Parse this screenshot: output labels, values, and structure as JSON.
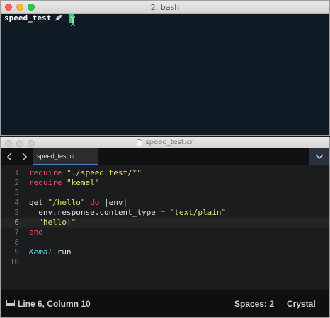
{
  "terminal": {
    "title": "2. bash",
    "prompt": "speed_test"
  },
  "editor": {
    "title": "speed_test.cr",
    "tab_label": "speed_test.cr",
    "lines": [
      {
        "num": "1",
        "parts": [
          {
            "t": "require",
            "c": "kw"
          },
          {
            "t": " "
          },
          {
            "t": "\"./speed_test/*\"",
            "c": "str"
          }
        ]
      },
      {
        "num": "2",
        "parts": [
          {
            "t": "require",
            "c": "kw"
          },
          {
            "t": " "
          },
          {
            "t": "\"kemal\"",
            "c": "str"
          }
        ]
      },
      {
        "num": "3",
        "parts": []
      },
      {
        "num": "4",
        "parts": [
          {
            "t": "get "
          },
          {
            "t": "\"/hello\"",
            "c": "str"
          },
          {
            "t": " "
          },
          {
            "t": "do",
            "c": "kw"
          },
          {
            "t": " |env|"
          }
        ]
      },
      {
        "num": "5",
        "parts": [
          {
            "t": "  env.response.content_type "
          },
          {
            "t": "=",
            "c": "kw"
          },
          {
            "t": " "
          },
          {
            "t": "\"text/plain\"",
            "c": "str"
          }
        ]
      },
      {
        "num": "6",
        "parts": [
          {
            "t": "  "
          },
          {
            "t": "\"hello!\"",
            "c": "str"
          }
        ]
      },
      {
        "num": "7",
        "parts": [
          {
            "t": "end",
            "c": "kw"
          }
        ]
      },
      {
        "num": "8",
        "parts": []
      },
      {
        "num": "9",
        "parts": [
          {
            "t": "Kemal",
            "c": "cls"
          },
          {
            "t": ".run"
          }
        ]
      },
      {
        "num": "10",
        "parts": []
      }
    ],
    "active_line": "6"
  },
  "statusbar": {
    "position": "Line 6, Column 10",
    "spaces": "Spaces: 2",
    "syntax": "Crystal"
  },
  "colors": {
    "terminal_bg": "#0f1b24",
    "cursor": "#2fc77a",
    "keyword": "#ef4b6a",
    "string": "#e6db74",
    "class": "#66d9ef",
    "tab_underline": "#4a84c8"
  },
  "icons": {
    "rocket": "rocket-icon",
    "file": "file-icon",
    "back": "chevron-left-icon",
    "forward": "chevron-right-icon",
    "dropdown": "chevron-down-icon",
    "status_panel": "panel-icon"
  }
}
